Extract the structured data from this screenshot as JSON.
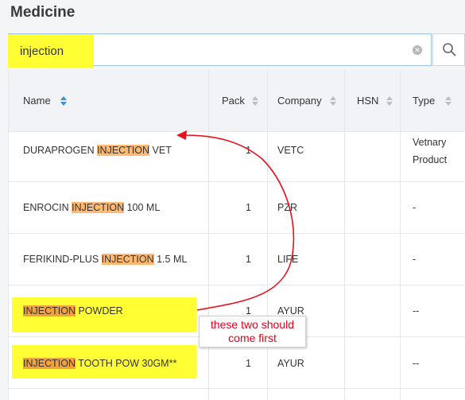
{
  "page": {
    "title": "Medicine"
  },
  "search": {
    "value": "injection"
  },
  "table": {
    "columns": [
      "Name",
      "Pack",
      "Company",
      "HSN",
      "Type"
    ],
    "rows": [
      {
        "name_pre": "DURAPROGEN ",
        "name_match": "INJECTION",
        "name_post": " VET",
        "pack": "1",
        "company": "VETC",
        "hsn": "",
        "type_line1": "Vetnary",
        "type_line2": "Product"
      },
      {
        "name_pre": "ENROCIN ",
        "name_match": "INJECTION",
        "name_post": " 100 ML",
        "pack": "1",
        "company": "PZR",
        "hsn": "",
        "type_line1": "-",
        "type_line2": ""
      },
      {
        "name_pre": "FERIKIND-PLUS ",
        "name_match": "INJECTION",
        "name_post": " 1.5 ML",
        "pack": "1",
        "company": "LIFE",
        "hsn": "",
        "type_line1": "-",
        "type_line2": ""
      },
      {
        "name_pre": "",
        "name_match": "INJECTION",
        "name_post": " POWDER",
        "pack": "1",
        "company": "AYUR",
        "hsn": "",
        "type_line1": "--",
        "type_line2": ""
      },
      {
        "name_pre": "",
        "name_match": "INJECTION",
        "name_post": " TOOTH POW 30GM**",
        "pack": "1",
        "company": "AYUR",
        "hsn": "",
        "type_line1": "--",
        "type_line2": ""
      }
    ]
  },
  "annotation": {
    "line1": "these two should",
    "line2": "come first"
  },
  "colors": {
    "highlight_yellow": "#ffff33",
    "match_orange": "#ffb970",
    "annotation_red": "#e3001b",
    "sort_active": "#3a8fd6"
  }
}
